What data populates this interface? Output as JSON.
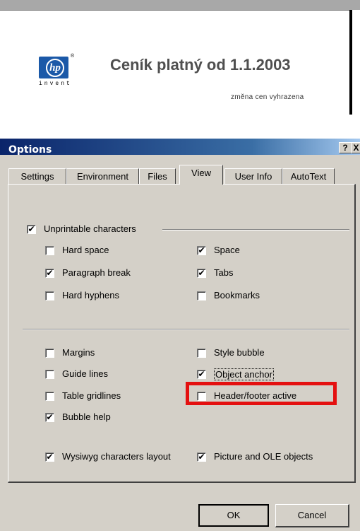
{
  "document": {
    "logo_text": "hp",
    "logo_tagline": "invent",
    "logo_reg": "®",
    "title": "Ceník platný od 1.1.2003",
    "subtitle": "změna cen vyhrazena"
  },
  "dialog": {
    "title": "Options",
    "help_button": "?",
    "close_button": "X",
    "tabs": [
      {
        "label": "Settings"
      },
      {
        "label": "Environment"
      },
      {
        "label": "Files"
      },
      {
        "label": "View",
        "active": true
      },
      {
        "label": "User Info"
      },
      {
        "label": "AutoText"
      }
    ],
    "group1": {
      "unprintable": {
        "label": "Unprintable characters",
        "checked": true
      },
      "hard_space": {
        "label": "Hard space",
        "checked": false
      },
      "space": {
        "label": "Space",
        "checked": true
      },
      "paragraph_break": {
        "label": "Paragraph break",
        "checked": true
      },
      "tabs": {
        "label": "Tabs",
        "checked": true
      },
      "hard_hyphens": {
        "label": "Hard hyphens",
        "checked": false
      },
      "bookmarks": {
        "label": "Bookmarks",
        "checked": false
      }
    },
    "group2": {
      "margins": {
        "label": "Margins",
        "checked": false
      },
      "style_bubble": {
        "label": "Style bubble",
        "checked": false
      },
      "guide_lines": {
        "label": "Guide lines",
        "checked": false
      },
      "object_anchor": {
        "label": "Object anchor",
        "checked": true
      },
      "table_gridlines": {
        "label": "Table gridlines",
        "checked": false
      },
      "header_footer": {
        "label": "Header/footer active",
        "checked": false
      },
      "bubble_help": {
        "label": "Bubble help",
        "checked": true
      },
      "wysiwyg": {
        "label": "Wysiwyg characters layout",
        "checked": true
      },
      "picture_ole": {
        "label": "Picture and OLE objects",
        "checked": true
      }
    },
    "ok_label": "OK",
    "cancel_label": "Cancel",
    "check_glyph": "✔",
    "highlight_color": "#e41010",
    "titlebar_color": "#0a246a"
  }
}
